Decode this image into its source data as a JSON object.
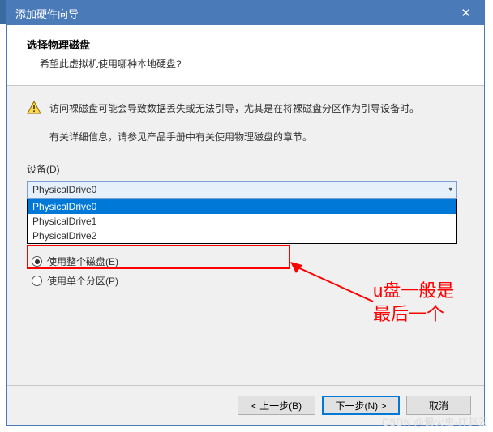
{
  "window": {
    "title": "添加硬件向导",
    "close_glyph": "✕"
  },
  "header": {
    "title": "选择物理磁盘",
    "subtitle": "希望此虚拟机使用哪种本地硬盘?"
  },
  "body": {
    "warning": "访问裸磁盘可能会导致数据丢失或无法引导，尤其是在将裸磁盘分区作为引导设备时。",
    "info": "有关详细信息，请参见产品手册中有关使用物理磁盘的章节。",
    "device_label": "设备(D)",
    "combo": {
      "selected": "PhysicalDrive0",
      "options": [
        "PhysicalDrive0",
        "PhysicalDrive1",
        "PhysicalDrive2"
      ],
      "highlighted_index": 0
    },
    "radios": {
      "use_entire": "使用整个磁盘(E)",
      "use_partition": "使用单个分区(P)",
      "selected": "use_entire"
    }
  },
  "footer": {
    "back": "< 上一步(B)",
    "next": "下一步(N) >",
    "cancel": "取消"
  },
  "annotation": {
    "line1": "u盘一般是",
    "line2": "最后一个"
  },
  "watermark": "CSDN @懒火虫-IT赵云"
}
